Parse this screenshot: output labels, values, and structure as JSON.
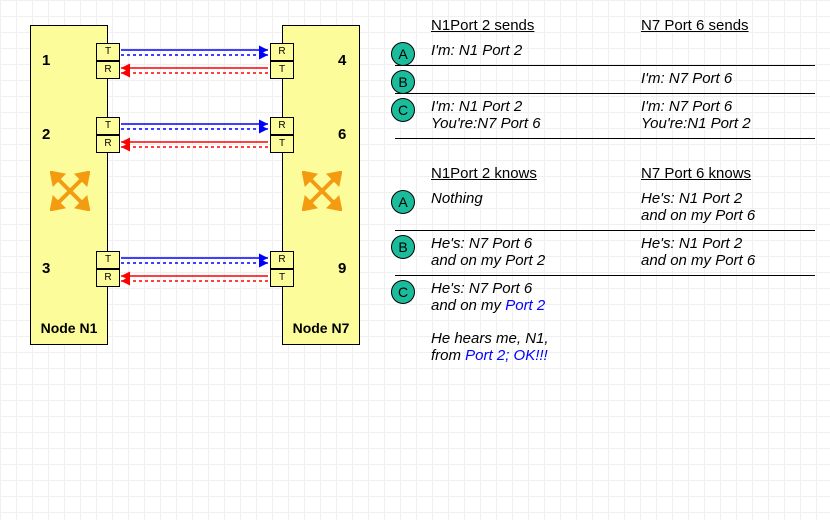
{
  "diagram": {
    "nodeLeft": {
      "label": "Node N1"
    },
    "nodeRight": {
      "label": "Node N7"
    },
    "portBlocks": {
      "tx": "T",
      "rx": "R"
    },
    "leftPorts": [
      "1",
      "2",
      "3"
    ],
    "rightPorts": [
      "4",
      "6",
      "9"
    ]
  },
  "sendsTable": {
    "headers": {
      "left": "N1Port 2 sends",
      "right": "N7 Port 6 sends"
    },
    "rows": [
      {
        "badge": "A",
        "left": "I'm: N1 Port 2",
        "right": ""
      },
      {
        "badge": "B",
        "left": "",
        "right": "I'm: N7 Port 6"
      },
      {
        "badge": "C",
        "left": "I'm: N1 Port 2\nYou're:N7 Port 6",
        "right": "I'm: N7 Port 6\nYou're:N1 Port 2"
      }
    ]
  },
  "knowsTable": {
    "headers": {
      "left": "N1Port 2 knows",
      "right": "N7 Port 6 knows"
    },
    "rows": [
      {
        "badge": "A",
        "left": "Nothing",
        "right": "He's: N1 Port 2\nand on my Port 6"
      },
      {
        "badge": "B",
        "left": "He's: N7 Port 6\nand on my Port 2",
        "right": "He's: N1 Port 2\nand on my Port 6"
      }
    ],
    "rowC": {
      "badge": "C",
      "leftPrefix": "He's: N7 Port 6\nand on my ",
      "leftBlue": "Port 2"
    },
    "note": {
      "prefix": "He hears me, N1,\nfrom ",
      "blue": "Port 2; OK!!!"
    }
  }
}
